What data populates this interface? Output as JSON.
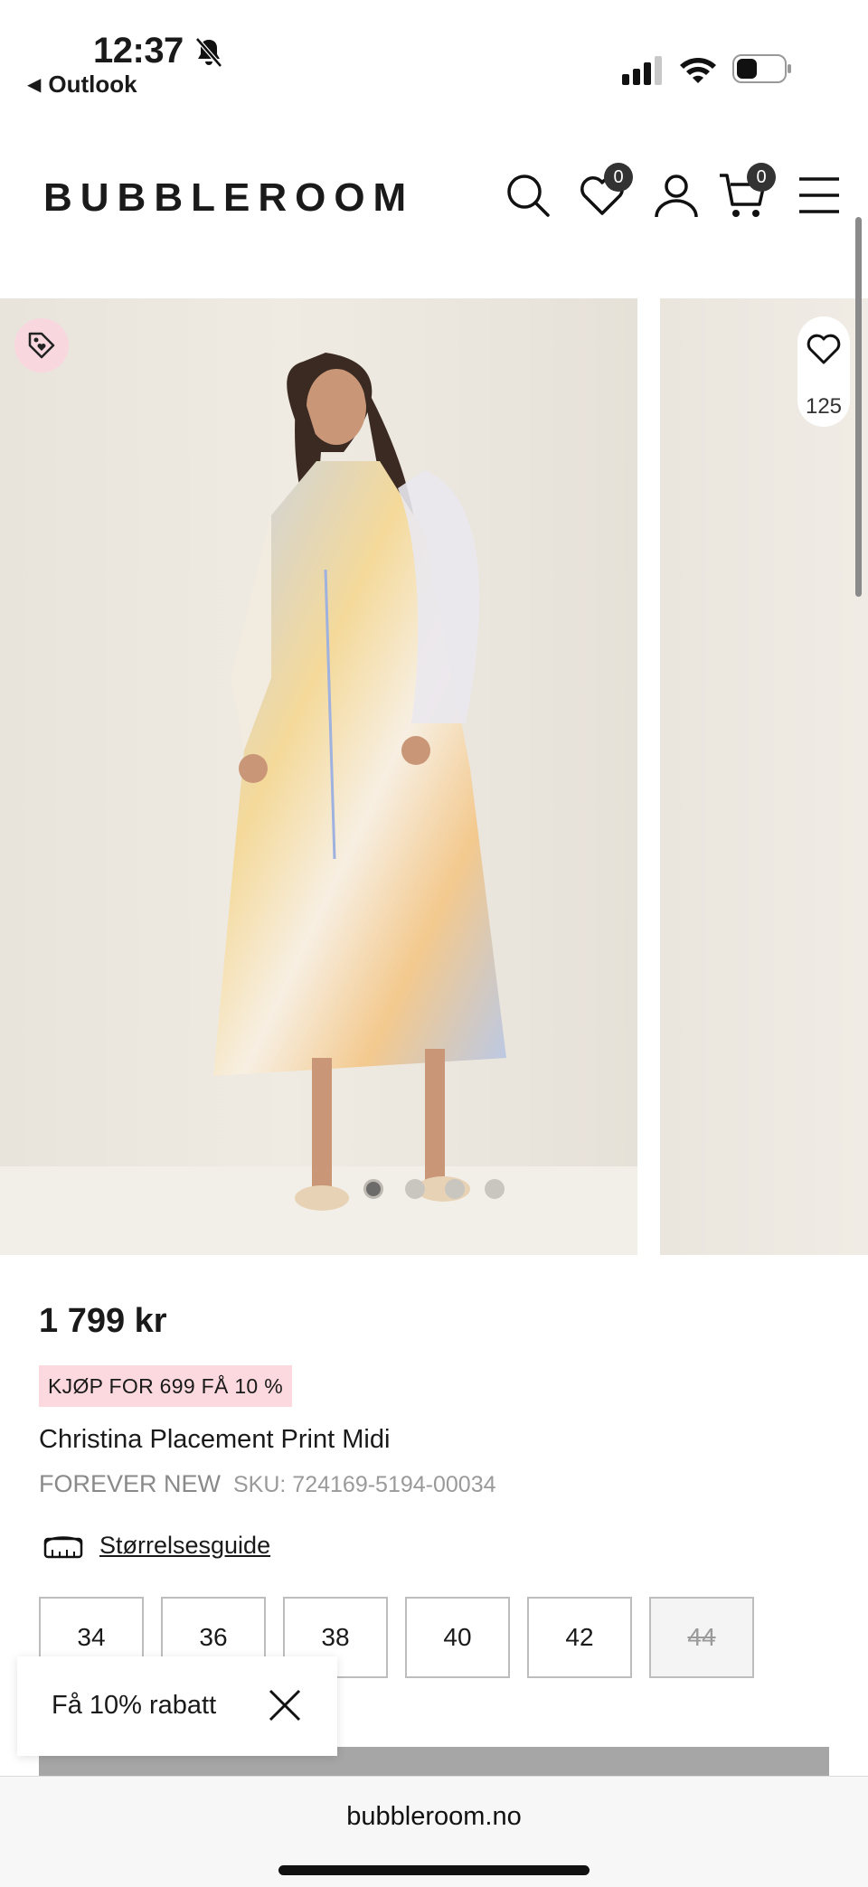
{
  "status_bar": {
    "time": "12:37",
    "back_app": "Outlook",
    "icons": [
      "bell-slash-icon",
      "signal-icon",
      "wifi-icon",
      "battery-icon"
    ]
  },
  "header": {
    "logo": "BUBBLEROOM",
    "wishlist_count": "0",
    "cart_count": "0",
    "icons": [
      "search-icon",
      "heart-icon",
      "user-icon",
      "cart-icon",
      "menu-icon"
    ]
  },
  "gallery": {
    "favorites_count": "125",
    "slide_count": 4,
    "active_slide": 1
  },
  "product": {
    "price": "1 799 kr",
    "promo": "KJØP FOR 699 FÅ 10 %",
    "title": "Christina Placement Print Midi",
    "brand": "FOREVER NEW",
    "sku": "SKU: 724169-5194-00034",
    "size_guide": "Størrelsesguide",
    "sizes": [
      {
        "label": "34",
        "available": true
      },
      {
        "label": "36",
        "available": true
      },
      {
        "label": "38",
        "available": true
      },
      {
        "label": "40",
        "available": true
      },
      {
        "label": "42",
        "available": true
      },
      {
        "label": "44",
        "available": false
      }
    ]
  },
  "popup": {
    "label": "Få 10% rabatt"
  },
  "browser": {
    "url": "bubbleroom.no"
  },
  "colors": {
    "promo_bg": "#fbd9de",
    "badge_bg": "#333333",
    "disabled_size_bg": "#f4f4f4",
    "add_bar": "#a6a6a6"
  }
}
